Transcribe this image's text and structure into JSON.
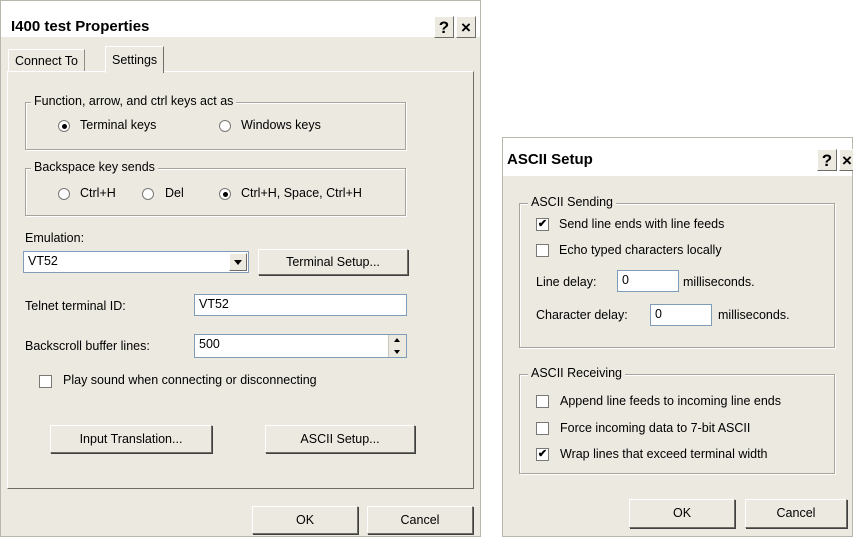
{
  "props": {
    "title": "I400 test Properties",
    "help_glyph": "?",
    "close_glyph": "×",
    "tabs": [
      {
        "label": "Connect To"
      },
      {
        "label": "Settings"
      }
    ],
    "keys_group": {
      "legend": "Function, arrow, and ctrl keys act as",
      "options": [
        {
          "label": "Terminal keys",
          "selected": true
        },
        {
          "label": "Windows keys",
          "selected": false
        }
      ]
    },
    "backspace_group": {
      "legend": "Backspace key sends",
      "options": [
        {
          "label": "Ctrl+H",
          "selected": false
        },
        {
          "label": "Del",
          "selected": false
        },
        {
          "label": "Ctrl+H, Space, Ctrl+H",
          "selected": true
        }
      ]
    },
    "emulation": {
      "label": "Emulation:",
      "value": "VT52"
    },
    "terminal_setup_label": "Terminal Setup...",
    "telnet_id": {
      "label": "Telnet terminal ID:",
      "value": "VT52"
    },
    "backscroll": {
      "label": "Backscroll buffer lines:",
      "value": "500"
    },
    "play_sound": {
      "label": "Play sound when connecting or disconnecting",
      "checked": false
    },
    "input_translation_label": "Input Translation...",
    "ascii_setup_label": "ASCII Setup...",
    "ok_label": "OK",
    "cancel_label": "Cancel"
  },
  "ascii": {
    "title": "ASCII Setup",
    "help_glyph": "?",
    "close_glyph": "×",
    "sending": {
      "legend": "ASCII Sending",
      "send_line_ends": {
        "label": "Send line ends with line feeds",
        "checked": true
      },
      "echo_typed": {
        "label": "Echo typed characters locally",
        "checked": false
      },
      "line_delay": {
        "label": "Line delay:",
        "value": "0",
        "unit": "milliseconds."
      },
      "char_delay": {
        "label": "Character delay:",
        "value": "0",
        "unit": "milliseconds."
      }
    },
    "receiving": {
      "legend": "ASCII Receiving",
      "append_lf": {
        "label": "Append line feeds to incoming line ends",
        "checked": false
      },
      "force_7bit": {
        "label": "Force incoming data to 7-bit ASCII",
        "checked": false
      },
      "wrap_lines": {
        "label": "Wrap lines that exceed terminal width",
        "checked": true
      }
    },
    "ok_label": "OK",
    "cancel_label": "Cancel"
  },
  "glyphs": {
    "check": "✔"
  },
  "colors": {
    "dialog_bg": "#ece9e1",
    "field_border": "#7f9db9"
  }
}
